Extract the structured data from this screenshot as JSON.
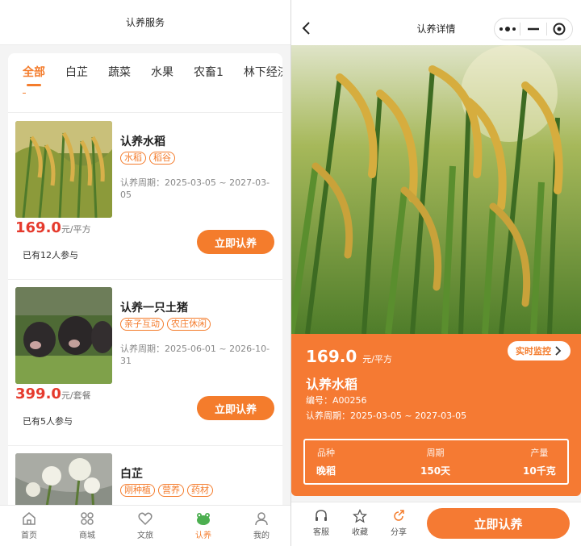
{
  "left": {
    "title": "认养服务",
    "tabs": [
      "全部",
      "白芷",
      "蔬菜",
      "水果",
      "农畜1",
      "林下经济"
    ],
    "cards": [
      {
        "title": "认养水稻",
        "tags": [
          "水稻",
          "稻谷"
        ],
        "period": "认养周期：2025-03-05 ~ 2027-03-05",
        "price": "169.0",
        "unit": "元/平方",
        "joined": "已有12人参与",
        "button": "立即认养"
      },
      {
        "title": "认养一只土猪",
        "tags": [
          "亲子互动",
          "农庄休闲"
        ],
        "period": "认养周期：2025-06-01 ~ 2026-10-31",
        "price": "399.0",
        "unit": "元/套餐",
        "joined": "已有5人参与",
        "button": "立即认养"
      },
      {
        "title": "白芷",
        "tags": [
          "刚种植",
          "营养",
          "药材"
        ]
      }
    ],
    "nav": [
      {
        "label": "首页",
        "icon": "home-icon"
      },
      {
        "label": "商城",
        "icon": "grid-icon"
      },
      {
        "label": "文旅",
        "icon": "heart-icon"
      },
      {
        "label": "认养",
        "icon": "frog-icon",
        "active": true
      },
      {
        "label": "我的",
        "icon": "user-icon"
      }
    ]
  },
  "right": {
    "title": "认养详情",
    "price": "169.0",
    "unit": "元/平方",
    "monitor": "实时监控",
    "name": "认养水稻",
    "code": "编号：A00256",
    "period": "认养周期：2025-03-05 ~ 2027-03-05",
    "specs": [
      {
        "key": "品种",
        "value": "晚稻"
      },
      {
        "key": "周期",
        "value": "150天"
      },
      {
        "key": "产量",
        "value": "10千克"
      }
    ],
    "actions": [
      {
        "label": "客服",
        "icon": "headset-icon"
      },
      {
        "label": "收藏",
        "icon": "star-icon"
      },
      {
        "label": "分享",
        "icon": "share-icon"
      }
    ],
    "button": "立即认养"
  },
  "colors": {
    "accent": "#f47c2c",
    "price": "#e53a2d"
  }
}
